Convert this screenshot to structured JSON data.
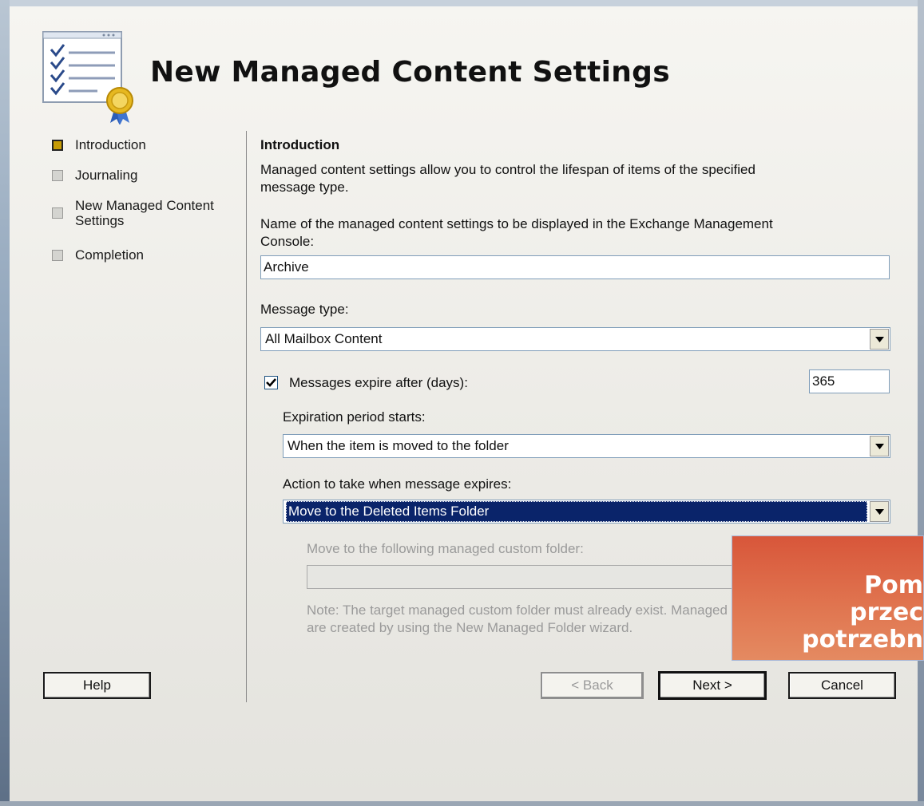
{
  "header": {
    "title": "New Managed Content Settings",
    "icon": "checklist-ribbon-icon"
  },
  "nav": {
    "items": [
      {
        "label": "Introduction",
        "state": "active"
      },
      {
        "label": "Journaling",
        "state": "pending"
      },
      {
        "label_line1": "New Managed Content",
        "label_line2": "Settings",
        "state": "pending"
      },
      {
        "label": "Completion",
        "state": "pending"
      }
    ]
  },
  "main": {
    "section_title": "Introduction",
    "description_line1": "Managed content settings allow you to control the lifespan of items of the specified",
    "description_line2": "message type.",
    "name_label_line1": "Name of the managed content settings to be displayed in the Exchange Management",
    "name_label_line2": "Console:",
    "name_value": "Archive",
    "message_type_label": "Message type:",
    "message_type_value": "All Mailbox Content",
    "expire_checkbox_label": "Messages expire after (days):",
    "expire_checked": true,
    "expire_days": "365",
    "expiration_start_label": "Expiration period starts:",
    "expiration_start_value": "When the item is moved to the folder",
    "action_label": "Action to take when message expires:",
    "action_value": "Move to the Deleted Items Folder",
    "move_folder_label": "Move to the following managed custom folder:",
    "move_folder_value": "",
    "note_line1": "Note: The target managed custom folder must already exist. Managed custom folders",
    "note_line2": "are created by using the New Managed Folder wizard."
  },
  "buttons": {
    "help": "Help",
    "back": "< Back",
    "next": "Next >",
    "cancel": "Cancel"
  },
  "overlay": {
    "line1": "Pom",
    "line2": "przec",
    "line3": "potrzebn",
    "color": "#d8563a"
  }
}
